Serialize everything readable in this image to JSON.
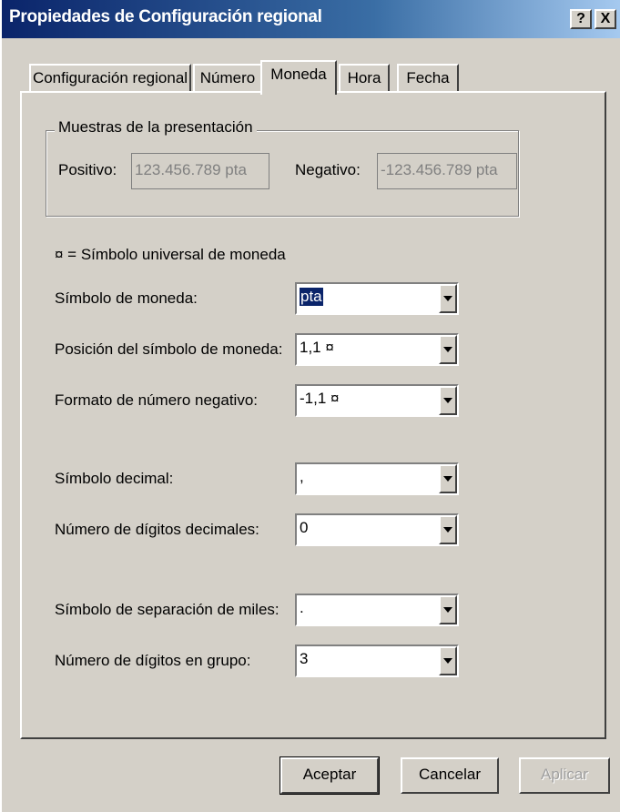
{
  "window": {
    "title": "Propiedades de Configuración regional",
    "help_label": "?",
    "close_label": "X"
  },
  "tabs": [
    {
      "label": "Configuración regional"
    },
    {
      "label": "Número"
    },
    {
      "label": "Moneda"
    },
    {
      "label": "Hora"
    },
    {
      "label": "Fecha"
    }
  ],
  "samples": {
    "group_label": "Muestras de la presentación",
    "positive_label": "Positivo:",
    "positive_value": "123.456.789 pta",
    "negative_label": "Negativo:",
    "negative_value": "-123.456.789 pta"
  },
  "universal_note": "¤ = Símbolo universal de moneda",
  "fields": {
    "currency_symbol": {
      "label": "Símbolo de moneda:",
      "value": "pta"
    },
    "symbol_position": {
      "label": "Posición del símbolo de moneda:",
      "value": "1,1 ¤"
    },
    "negative_format": {
      "label": "Formato de número negativo:",
      "value": "-1,1 ¤"
    },
    "decimal_symbol": {
      "label": "Símbolo decimal:",
      "value": ","
    },
    "decimal_digits": {
      "label": "Número de dígitos decimales:",
      "value": "0"
    },
    "thousands_separator": {
      "label": "Símbolo de separación de miles:",
      "value": "."
    },
    "group_digits": {
      "label": "Número de dígitos en grupo:",
      "value": "3"
    }
  },
  "buttons": {
    "ok": "Aceptar",
    "cancel": "Cancelar",
    "apply": "Aplicar"
  }
}
